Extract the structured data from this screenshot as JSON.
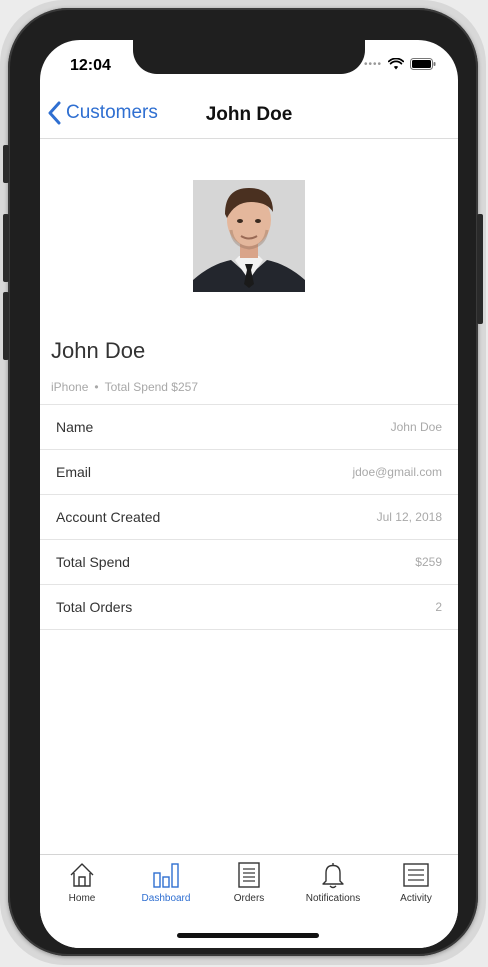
{
  "status_bar": {
    "time": "12:04"
  },
  "nav": {
    "back_label": "Customers",
    "title": "John Doe"
  },
  "profile": {
    "name": "John Doe",
    "device": "iPhone",
    "separator": "•",
    "spend_summary": "Total Spend $257"
  },
  "details": [
    {
      "label": "Name",
      "value": "John Doe"
    },
    {
      "label": "Email",
      "value": "jdoe@gmail.com"
    },
    {
      "label": "Account Created",
      "value": "Jul 12, 2018"
    },
    {
      "label": "Total Spend",
      "value": "$259"
    },
    {
      "label": "Total Orders",
      "value": "2"
    }
  ],
  "tabs": [
    {
      "label": "Home",
      "icon": "home-icon"
    },
    {
      "label": "Dashboard",
      "icon": "bar-chart-icon",
      "active": true
    },
    {
      "label": "Orders",
      "icon": "receipt-icon"
    },
    {
      "label": "Notifications",
      "icon": "bell-icon"
    },
    {
      "label": "Activity",
      "icon": "list-icon"
    }
  ],
  "colors": {
    "accent": "#2f6fd1",
    "text": "#333333",
    "muted": "#a9a9a9"
  }
}
